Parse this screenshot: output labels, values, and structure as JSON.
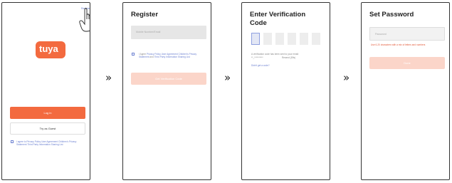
{
  "screen1": {
    "register_link": "Register",
    "logo_text": "tuya",
    "login_button": "Log in",
    "guest_button": "Try as Guest",
    "agreement_text": "I agree to Privacy Policy User Agreement Children's Privacy Statement Third Party Information Sharing List"
  },
  "screen2": {
    "title": "Register",
    "input_placeholder": "Mobile Number/Email",
    "agree_prefix": "I Agree",
    "agree_links": "Privacy Policy User Agreement Children's Privacy Statement",
    "agree_and": "and",
    "agree_tail": "Third Party Information Sharing List",
    "get_code_button": "Get Verification Code"
  },
  "screen3": {
    "title_line1": "Enter Verification",
    "title_line2": "Code",
    "sent_text": "A verification code has been sent to your email:",
    "masked_email": "**_**********",
    "resend_text": "Resend (59s)",
    "didnt_get": "Didn't get a code?"
  },
  "screen4": {
    "title": "Set Password",
    "password_placeholder": "Password",
    "hint": "Use 6-20 characters with a mix of letters and numbers",
    "done_button": "Done"
  },
  "arrow_glyph": "»",
  "colors": {
    "accent": "#f36a3f",
    "accent_pale": "#fbd5c9",
    "link": "#6a7fd0",
    "input_bg": "#e6e6e6"
  },
  "icons": [
    "hand-pointer-icon",
    "tuya-logo-icon",
    "checkbox-icon",
    "double-chevron-right-icon"
  ]
}
